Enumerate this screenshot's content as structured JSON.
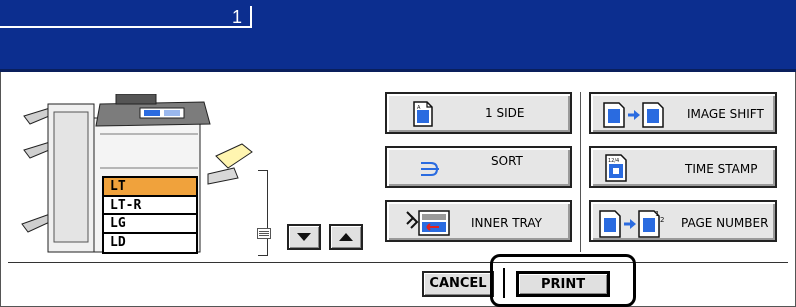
{
  "header": {
    "copy_count": "1"
  },
  "machine": {
    "icon": "copier-machine-icon"
  },
  "trays": [
    {
      "label": "LT",
      "selected": true
    },
    {
      "label": "LT-R",
      "selected": false
    },
    {
      "label": "LG",
      "selected": false
    },
    {
      "label": "LD",
      "selected": false
    }
  ],
  "functions": {
    "one_side": "1 SIDE",
    "sort": "SORT",
    "inner_tray": "INNER TRAY",
    "image_shift": "IMAGE SHIFT",
    "time_stamp": "TIME STAMP",
    "page_number": "PAGE NUMBER"
  },
  "footer": {
    "cancel": "CANCEL",
    "print": "PRINT"
  },
  "colors": {
    "title_bar": "#0c2e8f",
    "selected_tray": "#f0a23c",
    "button_face": "#e6e6e6",
    "icon_blue": "#2a6be0"
  }
}
